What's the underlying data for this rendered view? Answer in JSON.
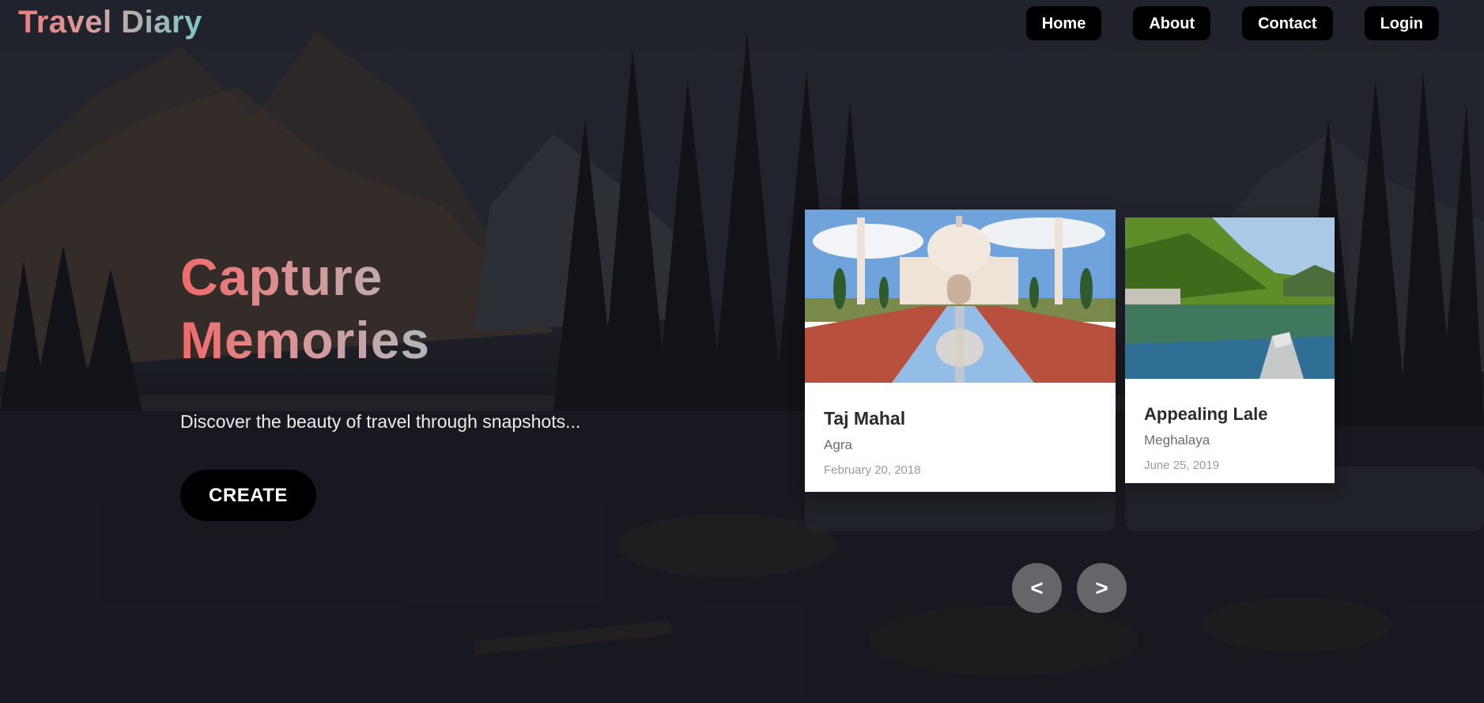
{
  "header": {
    "logo": "Travel Diary",
    "nav": [
      {
        "label": "Home"
      },
      {
        "label": "About"
      },
      {
        "label": "Contact"
      },
      {
        "label": "Login"
      }
    ]
  },
  "hero": {
    "title_line1": "Capture",
    "title_line2": "Memories",
    "subtitle": "Discover the beauty of travel through snapshots...",
    "cta_label": "CREATE"
  },
  "cards": [
    {
      "title": "Taj Mahal",
      "place": "Agra",
      "date": "February 20, 2018",
      "image": "taj-mahal-photo"
    },
    {
      "title": "Appealing Lale",
      "place": "Meghalaya",
      "date": "June 25, 2019",
      "image": "lake-boat-photo"
    }
  ],
  "slider": {
    "prev_label": "<",
    "next_label": ">"
  },
  "colors": {
    "logo_gradient": [
      "#f07a7a",
      "#cfa3a3",
      "#7cc8c0"
    ],
    "title_gradient": [
      "#f06a6a",
      "#d99494",
      "#b0b7bb"
    ],
    "button_bg": "#000000",
    "arrow_bg": "#737378"
  },
  "icons": {
    "prev": "chevron-left-text",
    "next": "chevron-right-text"
  }
}
